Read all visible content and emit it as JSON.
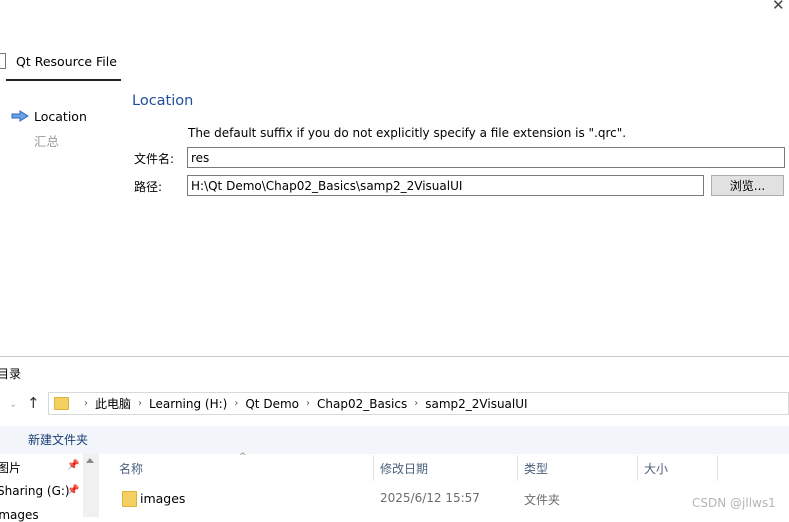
{
  "wizard": {
    "close_glyph": "✕",
    "tab_label": "Qt Resource File",
    "steps": [
      {
        "label": "Location",
        "active": true
      },
      {
        "label": "汇总",
        "active": false
      }
    ],
    "section_title": "Location",
    "hint": "The default suffix if you do not explicitly specify a file extension is \".qrc\".",
    "name_label": "文件名:",
    "name_value": "res",
    "path_label": "路径:",
    "path_value": "H:\\Qt Demo\\Chap02_Basics\\samp2_2VisualUI",
    "browse_label": "浏览..."
  },
  "explorer": {
    "title": "目录",
    "breadcrumb": [
      "此电脑",
      "Learning (H:)",
      "Qt Demo",
      "Chap02_Basics",
      "samp2_2VisualUI"
    ],
    "new_folder_label": "新建文件夹",
    "nav_items": [
      {
        "label": "图片",
        "pinned": true
      },
      {
        "label": "Sharing (G:)",
        "pinned": true
      },
      {
        "label": "images",
        "pinned": false
      }
    ],
    "columns": [
      "名称",
      "修改日期",
      "类型",
      "大小"
    ],
    "rows": [
      {
        "name": "images",
        "modified": "2025/6/12 15:57",
        "type": "文件夹",
        "size": ""
      }
    ],
    "watermark": "CSDN @jllws1"
  },
  "colors": {
    "accent_blue": "#1f4e9c",
    "folder_yellow": "#f4cf62",
    "toolbar_bg": "#f2f6fb"
  }
}
